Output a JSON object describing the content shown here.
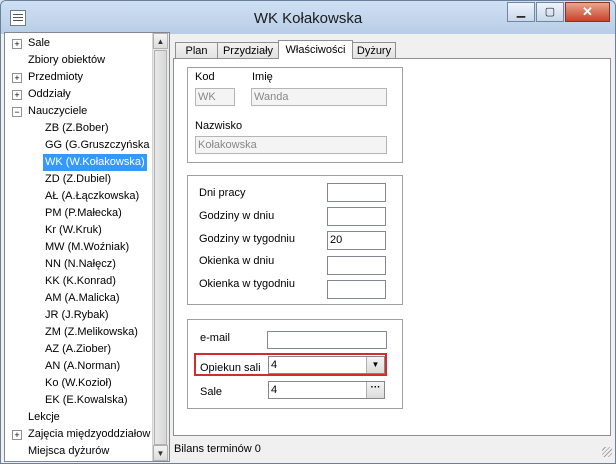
{
  "window": {
    "title": "WK Kołakowska"
  },
  "tree": {
    "items": [
      {
        "label": "Sale",
        "level": 0,
        "expander": "+"
      },
      {
        "label": "Zbiory obiektów",
        "level": 0,
        "expander": ""
      },
      {
        "label": "Przedmioty",
        "level": 0,
        "expander": "+"
      },
      {
        "label": "Oddziały",
        "level": 0,
        "expander": "+"
      },
      {
        "label": "Nauczyciele",
        "level": 0,
        "expander": "−"
      },
      {
        "label": "ZB (Z.Bober)",
        "level": 1,
        "expander": ""
      },
      {
        "label": "GG (G.Gruszczyńska",
        "level": 1,
        "expander": ""
      },
      {
        "label": "WK (W.Kołakowska)",
        "level": 1,
        "expander": "",
        "selected": true
      },
      {
        "label": "ZD (Z.Dubiel)",
        "level": 1,
        "expander": ""
      },
      {
        "label": "AŁ (A.Łączkowska)",
        "level": 1,
        "expander": ""
      },
      {
        "label": "PM (P.Małecka)",
        "level": 1,
        "expander": ""
      },
      {
        "label": "Kr (W.Kruk)",
        "level": 1,
        "expander": ""
      },
      {
        "label": "MW (M.Woźniak)",
        "level": 1,
        "expander": ""
      },
      {
        "label": "NN (N.Nałęcz)",
        "level": 1,
        "expander": ""
      },
      {
        "label": "KK (K.Konrad)",
        "level": 1,
        "expander": ""
      },
      {
        "label": "AM (A.Malicka)",
        "level": 1,
        "expander": ""
      },
      {
        "label": "JR (J.Rybak)",
        "level": 1,
        "expander": ""
      },
      {
        "label": "ZM (Z.Melikowska)",
        "level": 1,
        "expander": ""
      },
      {
        "label": "AZ (A.Ziober)",
        "level": 1,
        "expander": ""
      },
      {
        "label": "AN (A.Norman)",
        "level": 1,
        "expander": ""
      },
      {
        "label": "Ko (W.Kozioł)",
        "level": 1,
        "expander": ""
      },
      {
        "label": "EK (E.Kowalska)",
        "level": 1,
        "expander": ""
      },
      {
        "label": "Lekcje",
        "level": 0,
        "expander": ""
      },
      {
        "label": "Zajęcia międzyoddziałow",
        "level": 0,
        "expander": "+"
      },
      {
        "label": "Miejsca dyżurów",
        "level": 0,
        "expander": ""
      }
    ]
  },
  "tabs": [
    {
      "label": "Plan",
      "active": false
    },
    {
      "label": "Przydziały",
      "active": false
    },
    {
      "label": "Właściwości",
      "active": true
    },
    {
      "label": "Dyżury",
      "active": false
    }
  ],
  "form": {
    "kod_label": "Kod",
    "kod_value": "WK",
    "imie_label": "Imię",
    "imie_value": "Wanda",
    "nazwisko_label": "Nazwisko",
    "nazwisko_value": "Kołakowska",
    "dni_pracy_label": "Dni pracy",
    "dni_pracy_value": "",
    "godziny_w_dniu_label": "Godziny w dniu",
    "godziny_w_dniu_value": "",
    "godziny_w_tygodniu_label": "Godziny w tygodniu",
    "godziny_w_tygodniu_value": "20",
    "okienka_w_dniu_label": "Okienka w dniu",
    "okienka_w_dniu_value": "",
    "okienka_w_tygodniu_label": "Okienka w tygodniu",
    "okienka_w_tygodniu_value": "",
    "email_label": "e-mail",
    "email_value": "",
    "opiekun_sali_label": "Opiekun sali",
    "opiekun_sali_value": "4",
    "sale_label": "Sale",
    "sale_value": "4"
  },
  "status": {
    "text": "Bilans terminów 0"
  },
  "icons": {
    "minimize": "minimize-icon",
    "maximize": "maximize-icon",
    "close": "close-icon",
    "dropdown": "chevron-down-icon",
    "ellipsis": "ellipsis-icon"
  }
}
